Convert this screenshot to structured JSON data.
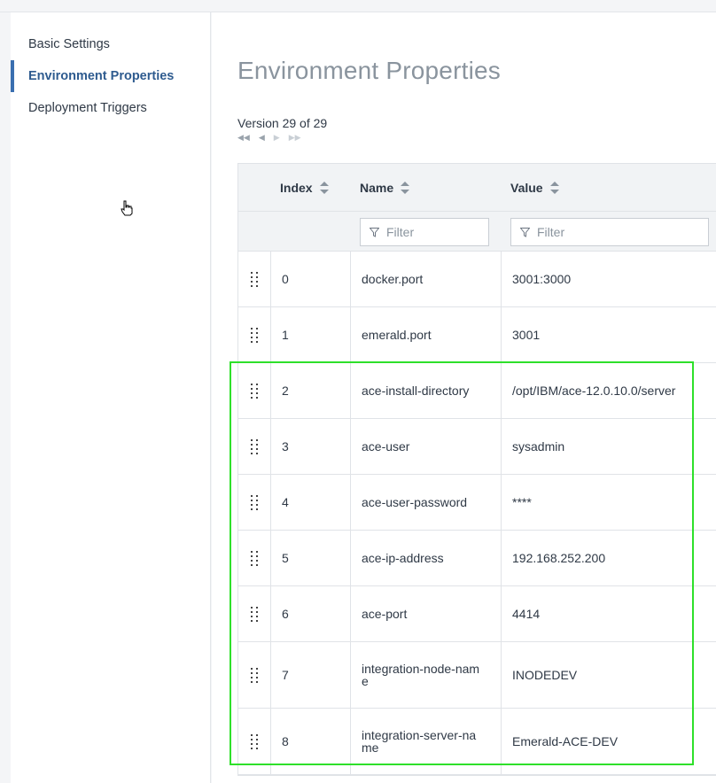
{
  "sidebar": {
    "items": [
      {
        "label": "Basic Settings",
        "active": false
      },
      {
        "label": "Environment Properties",
        "active": true
      },
      {
        "label": "Deployment Triggers",
        "active": false
      }
    ]
  },
  "main": {
    "title": "Environment Properties",
    "version_text": "Version 29 of 29",
    "pager": {
      "first": "◀◀",
      "prev": "◀",
      "next": "▶",
      "last": "▶▶"
    }
  },
  "table": {
    "columns": [
      "Index",
      "Name",
      "Value"
    ],
    "filter_placeholder": "Filter",
    "rows": [
      {
        "index": "0",
        "name": "docker.port",
        "value": "3001:3000"
      },
      {
        "index": "1",
        "name": "emerald.port",
        "value": "3001"
      },
      {
        "index": "2",
        "name": "ace-install-directory",
        "value": "/opt/IBM/ace-12.0.10.0/server"
      },
      {
        "index": "3",
        "name": "ace-user",
        "value": "sysadmin"
      },
      {
        "index": "4",
        "name": "ace-user-password",
        "value": "****"
      },
      {
        "index": "5",
        "name": "ace-ip-address",
        "value": "192.168.252.200"
      },
      {
        "index": "6",
        "name": "ace-port",
        "value": "4414"
      },
      {
        "index": "7",
        "name": "integration-node-name",
        "value": "INODEDEV"
      },
      {
        "index": "8",
        "name": "integration-server-name",
        "value": "Emerald-ACE-DEV"
      }
    ]
  },
  "colors": {
    "accent": "#3a6fb0",
    "highlight": "#2ee02a"
  }
}
